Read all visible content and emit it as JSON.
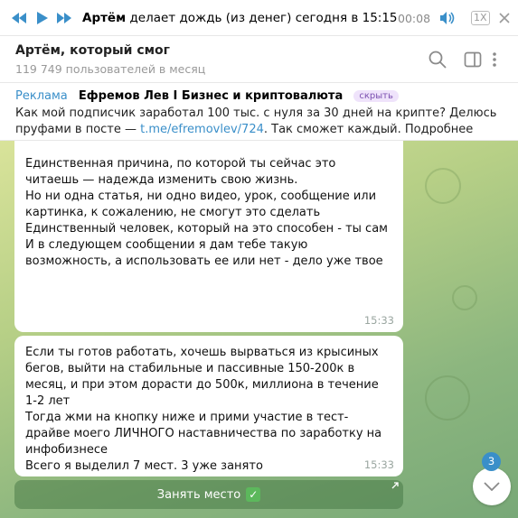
{
  "player": {
    "author": "Артём",
    "track": "делает дождь (из денег)",
    "date": "сегодня в 15:15",
    "time": "00:08",
    "speed": "1X"
  },
  "header": {
    "title": "Артём, который смог",
    "subtitle": "119 749 пользователей в месяц"
  },
  "sponsored": {
    "tag": "Реклама",
    "advertiser": "Ефремов Лев I Бизнес и криптовалюта",
    "hide_label": "скрыть",
    "text_before": "Как мой подписчик заработал 100 тыс. с нуля за 30 дней на крипте? Делюсь пруфами в посте — ",
    "link": "t.me/efremovlev/724",
    "text_after": ". Так сможет каждый. Подробнее"
  },
  "messages": [
    {
      "paragraphs": [
        "Единственная причина, по которой ты сейчас это читаешь — надежда изменить свою жизнь.",
        "Но ни одна статья, ни одно видео, урок, сообщение или картинка, к сожалению, не смогут это сделать",
        "Единственный человек, который на это способен - ты сам",
        "И в следующем сообщении я дам тебе такую возможность, а использовать ее или нет - дело уже твое"
      ],
      "time": "15:33"
    },
    {
      "paragraphs": [
        "Если ты готов работать, хочешь вырваться из крысиных бегов, выйти на стабильные и пассивные 150-200к в месяц, и при этом дорасти до 500к, миллиона в течение 1-2 лет",
        "Тогда жми на кнопку ниже и прими участие в тест-драйве моего ЛИЧНОГО наставничества по заработку на инфобизнесе",
        "Всего я выделил 7 мест. 3 уже занято"
      ],
      "time": "15:33"
    }
  ],
  "action_button": {
    "label": "Занять место",
    "check": "✓"
  },
  "scroll": {
    "unread_count": "3"
  },
  "colors": {
    "accent": "#3a8fc9",
    "chat_bg": "#a5c585"
  }
}
